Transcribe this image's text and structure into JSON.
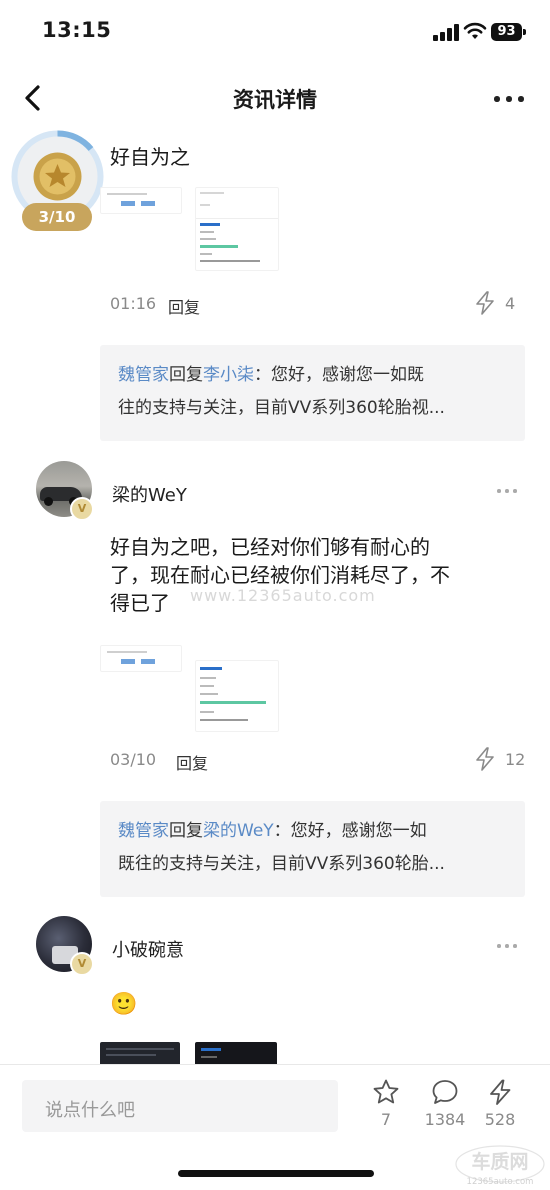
{
  "status": {
    "time": "13:15",
    "battery": "93"
  },
  "nav": {
    "title": "资讯详情"
  },
  "comments": [
    {
      "text": "好自为之",
      "level_badge": "3/10",
      "time": "01:16",
      "reply_label": "回复",
      "likes": "4",
      "reply": {
        "author": "魏管家",
        "reply_word": "回复",
        "target": "李小柒",
        "line1": "：您好，感谢您一如既",
        "line2": "往的支持与关注，目前VV系列360轮胎视..."
      }
    },
    {
      "user": "梁的WeY",
      "badge": "V",
      "text_lines": [
        "好自为之吧，已经对你们够有耐心的",
        "了，现在耐心已经被你们消耗尽了，不",
        "得已了"
      ],
      "time": "03/10",
      "reply_label": "回复",
      "likes": "12",
      "reply": {
        "author": "魏管家",
        "reply_word": "回复",
        "target": "梁的WeY",
        "line1": "：您好，感谢您一如",
        "line2": "既往的支持与关注，目前VV系列360轮胎..."
      }
    },
    {
      "user": "小破碗意",
      "badge": "V",
      "text": "🙂"
    }
  ],
  "bottom": {
    "placeholder": "说点什么吧",
    "star_count": "7",
    "comment_count": "1384",
    "like_count": "528"
  },
  "watermark": "www.12365auto.com",
  "logo": {
    "name": "车质网",
    "url": "12365auto.com"
  },
  "colors": {
    "accent_blue": "#5a8ac6",
    "reply_bg": "#f4f4f5",
    "gold": "#c9a24a",
    "progress_blue": "#7fb3e0"
  }
}
